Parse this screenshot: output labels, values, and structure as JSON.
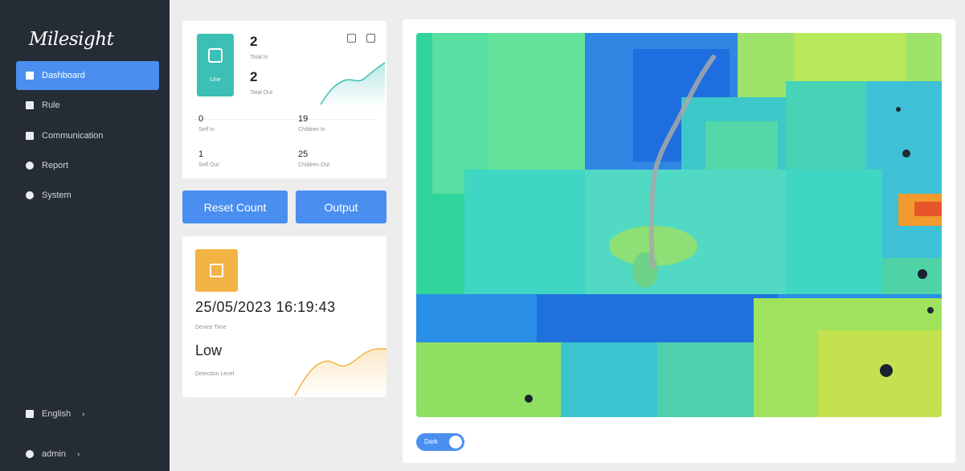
{
  "app": {
    "logo": "Milesight"
  },
  "sidebar": {
    "items": [
      {
        "label": "Dashboard",
        "icon": "dashboard-icon",
        "active": true
      },
      {
        "label": "Rule",
        "icon": "rule-icon",
        "active": false
      },
      {
        "label": "Communication",
        "icon": "communication-icon",
        "active": false
      },
      {
        "label": "Report",
        "icon": "report-icon",
        "active": false
      },
      {
        "label": "System",
        "icon": "system-icon",
        "active": false
      }
    ],
    "language": {
      "label": "English",
      "chevron": "›"
    },
    "user": {
      "label": "admin",
      "chevron": "›"
    }
  },
  "stats": {
    "tile_label": "Line",
    "primary_top": {
      "value": "2",
      "label": "Total In"
    },
    "primary_bottom": {
      "value": "2",
      "label": "Total Out"
    },
    "cells": [
      {
        "value": "0",
        "label": "Self In"
      },
      {
        "value": "19",
        "label": "Children In"
      },
      {
        "value": "1",
        "label": "Self Out"
      },
      {
        "value": "25",
        "label": "Children Out"
      }
    ]
  },
  "buttons": {
    "reset": "Reset Count",
    "output": "Output"
  },
  "status": {
    "datetime": "25/05/2023 16:19:43",
    "datetime_label": "Device Time",
    "level": "Low",
    "level_label": "Detection Level"
  },
  "view": {
    "toggle_label": "Dark",
    "toggle_on": true
  },
  "colors": {
    "accent": "#4a8ff0",
    "sidebar_bg": "#262c36",
    "tile_teal": "#3cbfb4",
    "tile_orange": "#f2b444"
  }
}
